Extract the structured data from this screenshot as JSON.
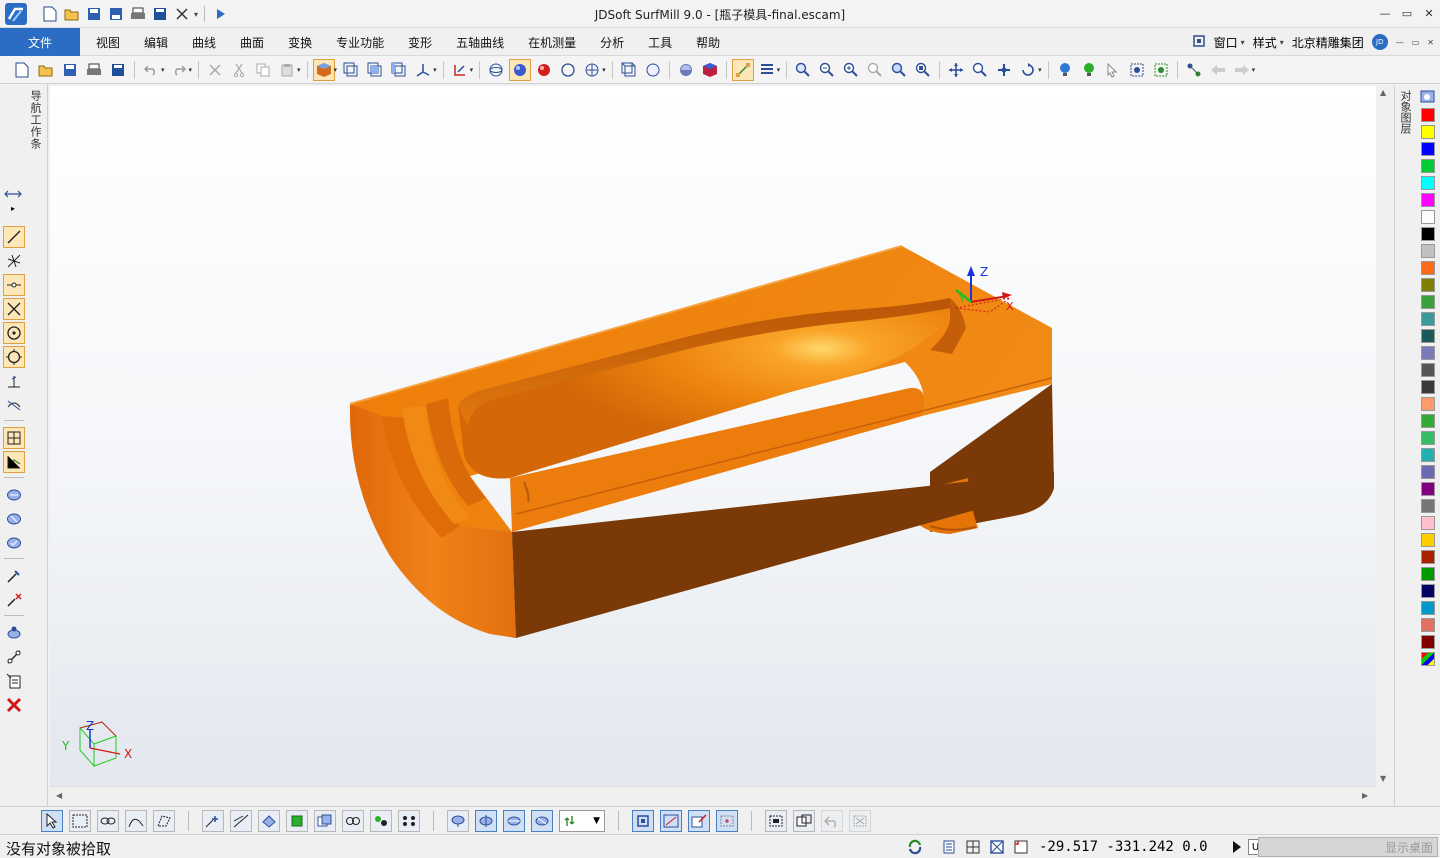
{
  "window": {
    "title": "JDSoft SurfMill 9.0 - [瓶子模具-final.escam]",
    "controls": [
      "—",
      "▭",
      "✕"
    ]
  },
  "menu": {
    "file_tab": "文件",
    "items": [
      "视图",
      "编辑",
      "曲线",
      "曲面",
      "变换",
      "专业功能",
      "变形",
      "五轴曲线",
      "在机测量",
      "分析",
      "工具",
      "帮助"
    ],
    "right": {
      "window": "窗口",
      "style": "样式",
      "company": "北京精雕集团",
      "badge": "JD"
    }
  },
  "panels": {
    "left_tab": "导航工作条",
    "right_tab": "对象图层"
  },
  "viewport": {
    "axis_labels": {
      "x": "X",
      "y": "Y",
      "z": "Z"
    }
  },
  "layer_colors": [
    "#ff0000",
    "#ffff00",
    "#0000ff",
    "#00cc33",
    "#00ffff",
    "#ff00ff",
    "#ffffff",
    "#000000",
    "#c0c0c0",
    "#ff6a1a",
    "#808000",
    "#3aa23a",
    "#3a9a9a",
    "#1a5a5a",
    "#7a7ab8",
    "#555555",
    "#3a3a3a",
    "#ff9a6a",
    "#33aa33",
    "#33bb66",
    "#22b0b0",
    "#6a6ab0",
    "#800080",
    "#777777",
    "#ffc0cb",
    "#ffcc00",
    "#aa2200",
    "#009900",
    "#000066",
    "#0099cc",
    "#e07060",
    "#800000",
    "multicolor"
  ],
  "status": {
    "message": "没有对象被拾取",
    "coordinates": "-29.517  -331.242  0.0",
    "unit_toggle": "U",
    "desktop_button": "显示桌面"
  },
  "colors": {
    "accent": "#2b6cc4",
    "model_orange": "#f28a16",
    "model_shadow": "#7c3a06",
    "axis_x": "#d01818",
    "axis_y": "#1fbf1f",
    "axis_z": "#1a34d8"
  }
}
